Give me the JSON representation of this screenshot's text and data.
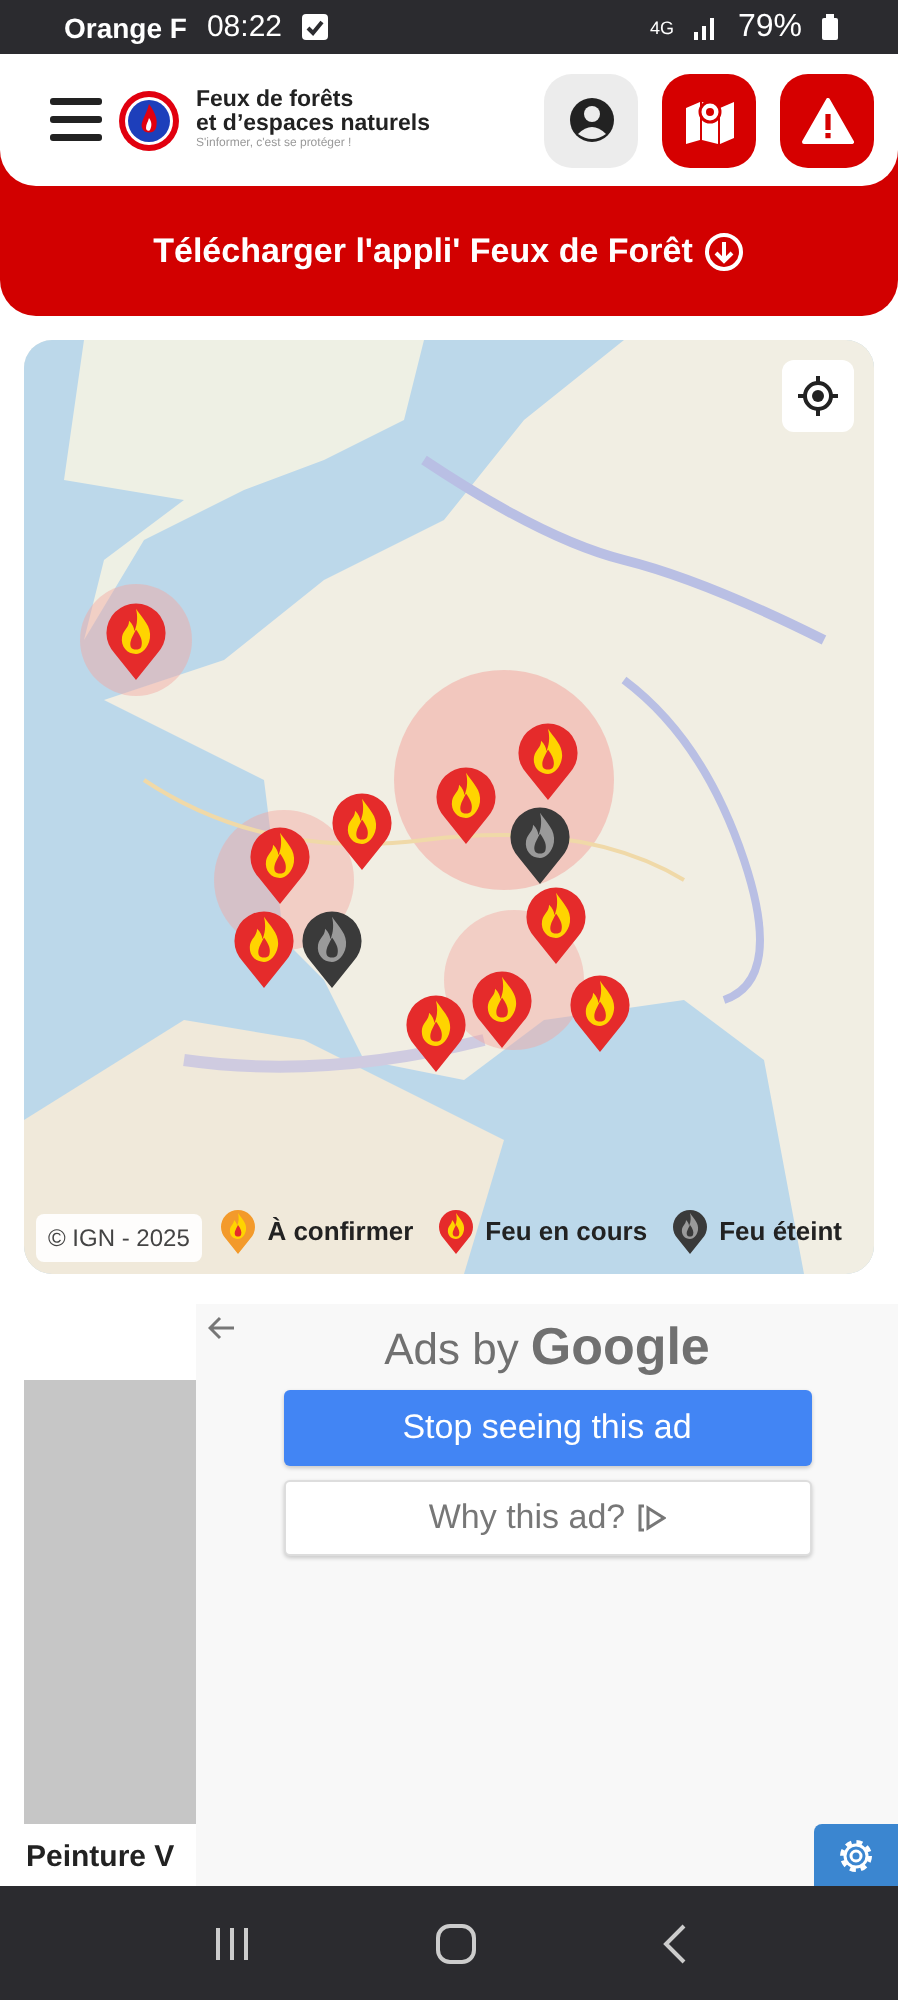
{
  "status_bar": {
    "carrier": "Orange F",
    "time": "08:22",
    "network": "4G",
    "battery": "79%"
  },
  "header": {
    "title_line_1": "Feux de forêts",
    "title_line_2": "et d’espaces naturels",
    "tagline": "S'informer, c'est se protéger !"
  },
  "banner": {
    "label": "Télécharger l'appli' Feux de Forêt"
  },
  "map": {
    "kind": "picture",
    "attribution": "© IGN - 2025",
    "markers": [
      {
        "kind": "active"
      },
      {
        "kind": "active"
      },
      {
        "kind": "active"
      },
      {
        "kind": "active"
      },
      {
        "kind": "out"
      },
      {
        "kind": "active"
      },
      {
        "kind": "active"
      },
      {
        "kind": "active"
      },
      {
        "kind": "active"
      },
      {
        "kind": "active"
      },
      {
        "kind": "active"
      },
      {
        "kind": "out"
      }
    ],
    "legend": [
      {
        "kind": "unconfirmed",
        "label": "À confirmer"
      },
      {
        "kind": "active",
        "label": "Feu en cours"
      },
      {
        "kind": "out",
        "label": "Feu éteint"
      }
    ]
  },
  "ad": {
    "item_title": "Peinture V",
    "heading_prefix": "Ads by",
    "heading_brand": "Google",
    "buttons": [
      {
        "kind": "primary",
        "label": "Stop seeing this ad"
      },
      {
        "kind": "secondary",
        "label": "Why this ad?"
      }
    ]
  }
}
